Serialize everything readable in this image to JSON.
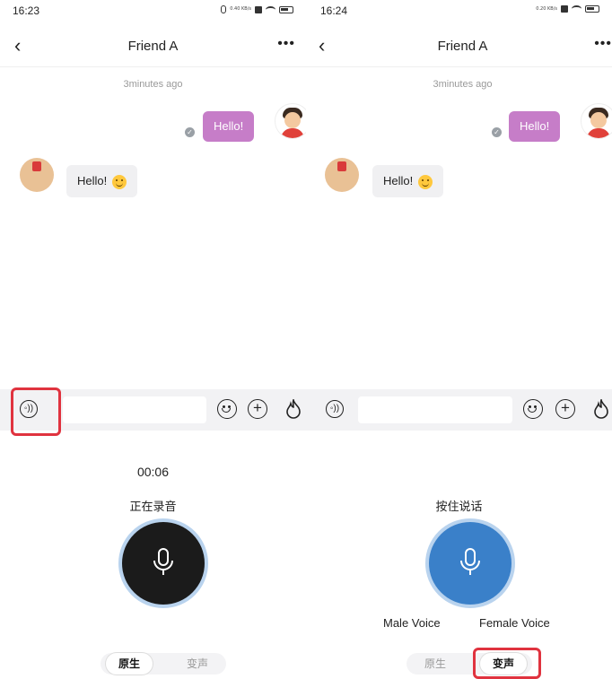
{
  "left": {
    "status": {
      "time": "16:23",
      "speed": "0.40 KB/s"
    },
    "nav": {
      "back": "‹",
      "title": "Friend A",
      "more": "•••"
    },
    "chat": {
      "timestamp": "3minutes ago",
      "my_message": "Hello!",
      "friend_message": "Hello!"
    },
    "input": {
      "value": ""
    },
    "recording": {
      "timer": "00:06",
      "label": "正在录音"
    },
    "mode_tabs": [
      {
        "label": "原生",
        "active": true
      },
      {
        "label": "变声",
        "active": false
      }
    ],
    "accent": "#1b1b1b"
  },
  "right": {
    "status": {
      "time": "16:24",
      "speed": "0.20 KB/s"
    },
    "nav": {
      "back": "‹",
      "title": "Friend A",
      "more": "•••"
    },
    "chat": {
      "timestamp": "3minutes ago",
      "my_message": "Hello!",
      "friend_message": "Hello!"
    },
    "input": {
      "value": ""
    },
    "recording": {
      "label": "按住说话"
    },
    "voice_options": {
      "male": "Male Voice",
      "female": "Female Voice"
    },
    "mode_tabs": [
      {
        "label": "原生",
        "active": false
      },
      {
        "label": "变声",
        "active": true
      }
    ],
    "accent": "#3a80c9"
  },
  "colors": {
    "my_bubble": "#c67dc8",
    "highlight": "#e0333f",
    "mic_ring": "#b9d3ee"
  },
  "icons": [
    "back-chevron-icon",
    "more-dots-icon",
    "voice-icon",
    "emoji-icon",
    "plus-icon",
    "flame-icon",
    "microphone-icon",
    "read-check-icon"
  ]
}
